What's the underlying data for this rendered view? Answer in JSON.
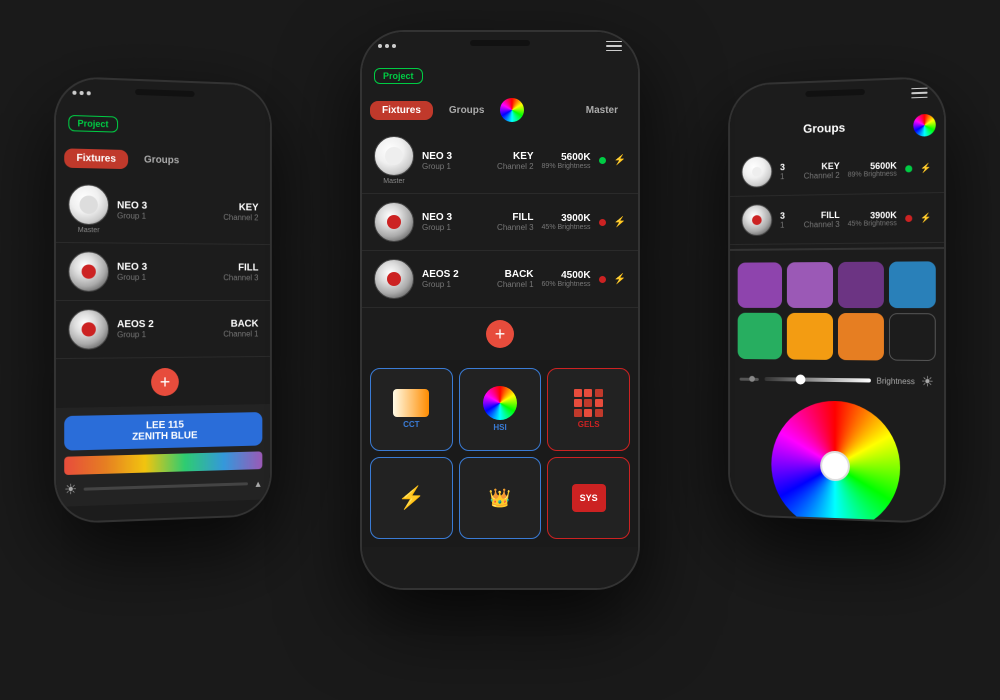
{
  "phones": {
    "left": {
      "project_badge": "Project",
      "tabs": [
        "Fixtures",
        "Groups"
      ],
      "fixtures": [
        {
          "name": "NEO 3",
          "group": "Group 1",
          "role": "KEY",
          "channel": "Channel 2",
          "thumb": "bright",
          "is_master": true
        },
        {
          "name": "NEO 3",
          "group": "Group 1",
          "role": "FILL",
          "channel": "Channel 3",
          "thumb": "dim"
        },
        {
          "name": "AEOS 2",
          "group": "Group 1",
          "role": "BACK",
          "channel": "Channel 1",
          "thumb": "dim"
        }
      ],
      "gel_button": "LEE 115\nZENITH BLUE",
      "add_label": "+"
    },
    "center": {
      "project_badge": "Project",
      "tabs": [
        "Fixtures",
        "Groups",
        "",
        "Master"
      ],
      "fixtures": [
        {
          "name": "NEO 3",
          "group": "Group 1",
          "role": "KEY",
          "channel": "Channel 2",
          "temp": "5600K",
          "brightness": "89% Brightness",
          "status": "green",
          "bolt": "yellow",
          "is_master": true
        },
        {
          "name": "NEO 3",
          "group": "Group 1",
          "role": "FILL",
          "channel": "Channel 3",
          "temp": "3900K",
          "brightness": "45% Brightness",
          "status": "red",
          "bolt": "gray"
        },
        {
          "name": "AEOS 2",
          "group": "Group 1",
          "role": "BACK",
          "channel": "Channel 1",
          "temp": "4500K",
          "brightness": "60% Brightness",
          "status": "red",
          "bolt": "gray"
        }
      ],
      "add_label": "+",
      "icons": [
        {
          "type": "cct",
          "label": "CCT"
        },
        {
          "type": "hsi",
          "label": "HSI"
        },
        {
          "type": "gels",
          "label": "GELS"
        },
        {
          "type": "lightning",
          "label": ""
        },
        {
          "type": "crown",
          "label": ""
        },
        {
          "type": "sys",
          "label": ""
        }
      ]
    },
    "right": {
      "tabs": [
        "Groups"
      ],
      "fixtures": [
        {
          "name": "3",
          "group": "1",
          "role": "KEY",
          "channel": "Channel 2",
          "temp": "5600K",
          "brightness": "89% Brightness",
          "status": "green",
          "bolt": "yellow"
        },
        {
          "name": "3",
          "group": "1",
          "role": "FILL",
          "channel": "Channel 3",
          "temp": "3900K",
          "brightness": "45% Brightness",
          "status": "red",
          "bolt": "gray"
        }
      ],
      "swatches": [
        "#8e44ad",
        "#9b59b6",
        "#6c3483",
        "#2980b9",
        "#27ae60",
        "#f39c12",
        "#e67e22",
        ""
      ],
      "brightness_label": "Brightness"
    }
  }
}
